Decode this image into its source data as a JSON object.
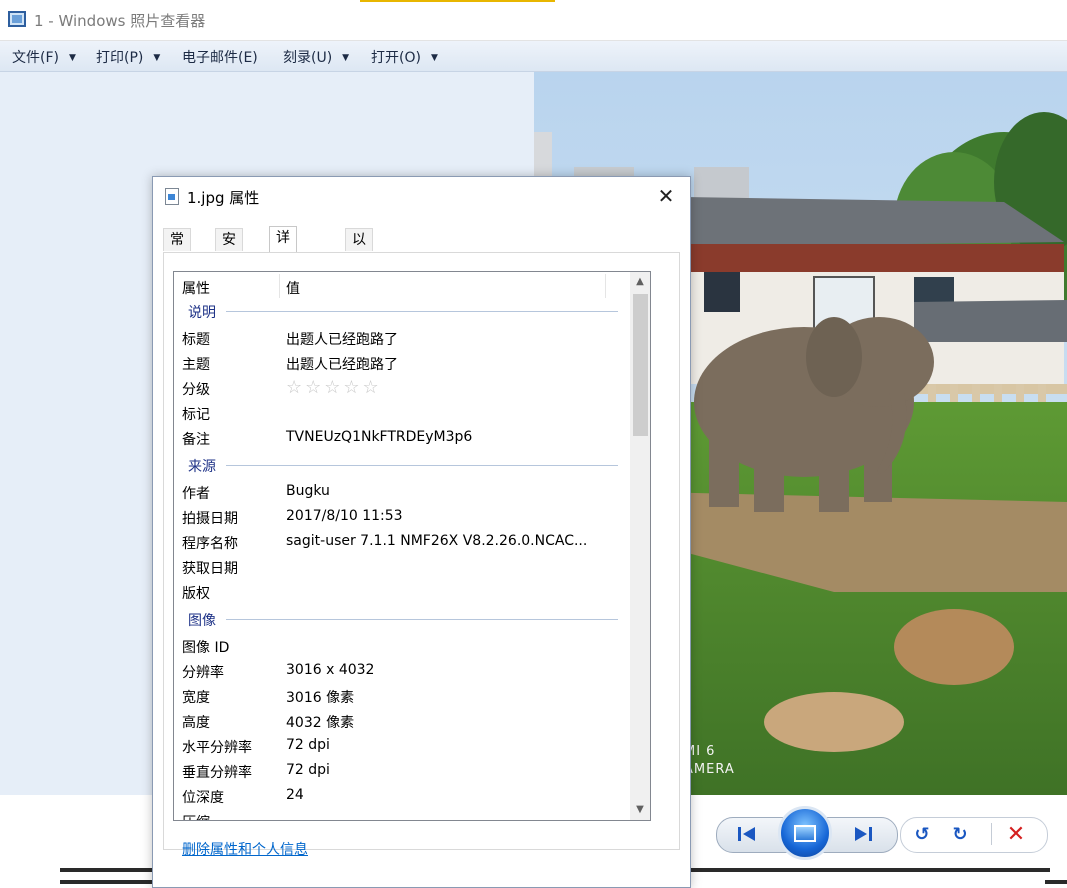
{
  "window": {
    "title": "1 - Windows 照片查看器",
    "icon": "photo-viewer-icon"
  },
  "menu": [
    {
      "label": "文件(F)",
      "has_dropdown": true
    },
    {
      "label": "打印(P)",
      "has_dropdown": true
    },
    {
      "label": "电子邮件(E)",
      "has_dropdown": false
    },
    {
      "label": "刻录(U)",
      "has_dropdown": true
    },
    {
      "label": "打开(O)",
      "has_dropdown": true
    }
  ],
  "photo": {
    "description_icon": "elephant-photo",
    "watermark_line1": "MI 6",
    "watermark_line2": "AMERA"
  },
  "dialog": {
    "title": "1.jpg 属性",
    "close_icon": "close-icon",
    "tabs": [
      "常规",
      "安全",
      "详细信息",
      "以前的版本"
    ],
    "active_tab": "详细信息",
    "header": {
      "col1": "属性",
      "col2": "值"
    },
    "groups": {
      "description": {
        "label": "说明",
        "rows": [
          {
            "key": "标题",
            "value": "出题人已经跑路了"
          },
          {
            "key": "主题",
            "value": "出题人已经跑路了"
          },
          {
            "key": "分级",
            "value": "☆☆☆☆☆"
          },
          {
            "key": "标记",
            "value": ""
          },
          {
            "key": "备注",
            "value": "TVNEUzQ1NkFTRDEyM3p6"
          }
        ]
      },
      "origin": {
        "label": "来源",
        "rows": [
          {
            "key": "作者",
            "value": "Bugku"
          },
          {
            "key": "拍摄日期",
            "value": "2017/8/10 11:53"
          },
          {
            "key": "程序名称",
            "value": "sagit-user 7.1.1 NMF26X V8.2.26.0.NCAC..."
          },
          {
            "key": "获取日期",
            "value": ""
          },
          {
            "key": "版权",
            "value": ""
          }
        ]
      },
      "image": {
        "label": "图像",
        "rows": [
          {
            "key": "图像 ID",
            "value": ""
          },
          {
            "key": "分辨率",
            "value": "3016 x 4032"
          },
          {
            "key": "宽度",
            "value": "3016 像素"
          },
          {
            "key": "高度",
            "value": "4032 像素"
          },
          {
            "key": "水平分辨率",
            "value": "72 dpi"
          },
          {
            "key": "垂直分辨率",
            "value": "72 dpi"
          },
          {
            "key": "位深度",
            "value": "24"
          },
          {
            "key": "压缩",
            "value": ""
          }
        ]
      }
    },
    "remove_link": "删除属性和个人信息"
  },
  "controls": {
    "prev_icon": "previous-icon",
    "slideshow_icon": "slideshow-icon",
    "next_icon": "next-icon",
    "rotate_ccw_icon": "rotate-counterclockwise-icon",
    "rotate_cw_icon": "rotate-clockwise-icon",
    "delete_icon": "delete-icon",
    "accent": "#1a57c1",
    "delete_color": "#d41f1f"
  }
}
